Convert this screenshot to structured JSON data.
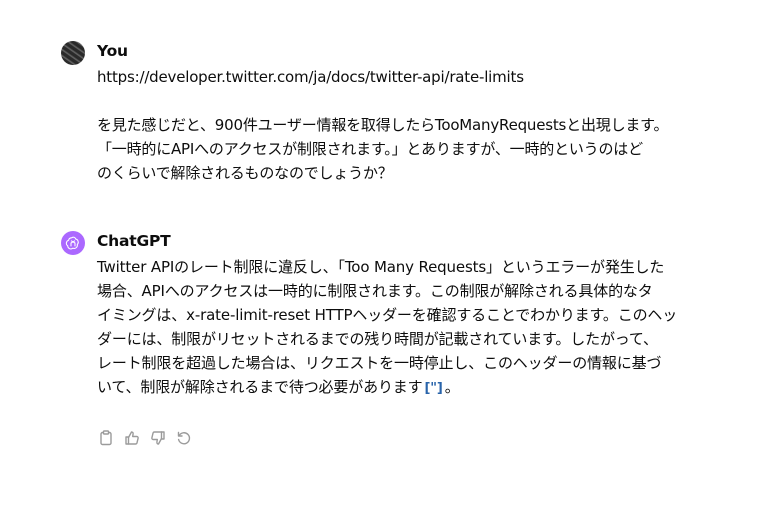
{
  "conversation": {
    "user": {
      "name": "You",
      "lines": [
        "https://developer.twitter.com/ja/docs/twitter-api/rate-limits",
        "",
        "を見た感じだと、900件ユーザー情報を取得したらTooManyRequestsと出現します。",
        "「一時的にAPIへのアクセスが制限されます。」とありますが、一時的というのはど",
        "のくらいで解除されるものなのでしょうか？"
      ]
    },
    "assistant": {
      "name": "ChatGPT",
      "lines": [
        "Twitter APIのレート制限に違反し、「Too Many Requests」というエラーが発生した",
        "場合、APIへのアクセスは一時的に制限されます。この制限が解除される具体的なタ",
        "イミングは、x-rate-limit-reset HTTPヘッダーを確認することでわかります。このヘッ",
        "ダーには、制限がリセットされるまでの残り時間が記載されています。したがって、",
        "レート制限を超過した場合は、リクエストを一時停止し、このヘッダーの情報に基づ"
      ],
      "last_line_text": "いて、制限が解除されるまで待つ必要があります",
      "citation": "[\"]",
      "last_line_end": "。"
    },
    "actions": [
      "copy-icon",
      "thumbs-up-icon",
      "thumbs-down-icon",
      "regenerate-icon"
    ]
  }
}
